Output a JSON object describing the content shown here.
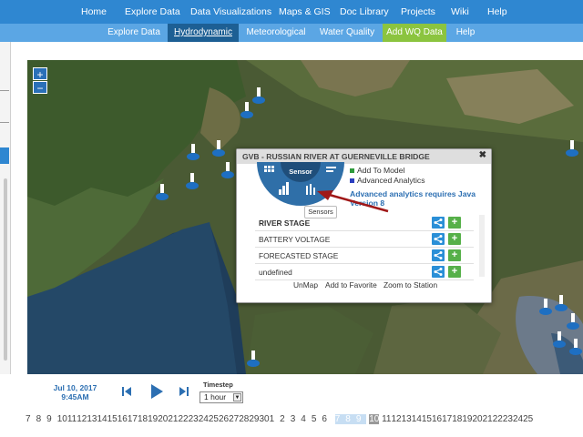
{
  "nav": {
    "items": [
      "Home",
      "Explore Data",
      "Data Visualizations",
      "Maps & GIS",
      "Doc Library",
      "Projects",
      "Wiki",
      "Help"
    ]
  },
  "subnav": {
    "items": [
      "Explore Data",
      "Hydrodynamic",
      "Meteorological",
      "Water Quality",
      "Add WQ Data",
      "Help"
    ],
    "active": "Hydrodynamic"
  },
  "map": {
    "zoom_in": "+",
    "zoom_out": "−"
  },
  "popup": {
    "title": "GVB - RUSSIAN RIVER AT GUERNEVILLE BRIDGE",
    "close": "✖",
    "wheel_label": "Sensor",
    "tooltip": "Sensors",
    "options": [
      "Add To Model",
      "Advanced Analytics"
    ],
    "option_colors": [
      "#2e9a3c",
      "#2b3fbf"
    ],
    "warning": "Advanced analytics requires Java Version 8",
    "sensors": [
      "RIVER STAGE",
      "BATTERY VOLTAGE",
      "FORECASTED STAGE",
      "undefined"
    ],
    "links": [
      "UnMap",
      "Add to Favorite",
      "Zoom to Station"
    ]
  },
  "timeline": {
    "date": "Jul 10, 2017",
    "time": "9:45AM",
    "timestep_label": "Timestep",
    "timestep_value": "1 hour",
    "days_a": [
      "7",
      "8",
      "9",
      "10",
      "11",
      "12",
      "13",
      "14",
      "15",
      "16",
      "17",
      "18",
      "19",
      "20",
      "21",
      "22",
      "23",
      "24",
      "25",
      "26",
      "27",
      "28",
      "29",
      "30",
      "1",
      "2",
      "3",
      "4",
      "5",
      "6"
    ],
    "days_hl": [
      "7",
      "8",
      "9"
    ],
    "day_current": "10",
    "days_b": [
      "11",
      "12",
      "13",
      "14",
      "15",
      "16",
      "17",
      "18",
      "19",
      "20",
      "21",
      "22",
      "23",
      "24",
      "25"
    ]
  },
  "colors": {
    "nav": "#2f87d1",
    "subnav": "#5ba6e4",
    "active_tab": "#1d5f94",
    "add_wq": "#8bc43f",
    "accent": "#2c6fb2"
  }
}
